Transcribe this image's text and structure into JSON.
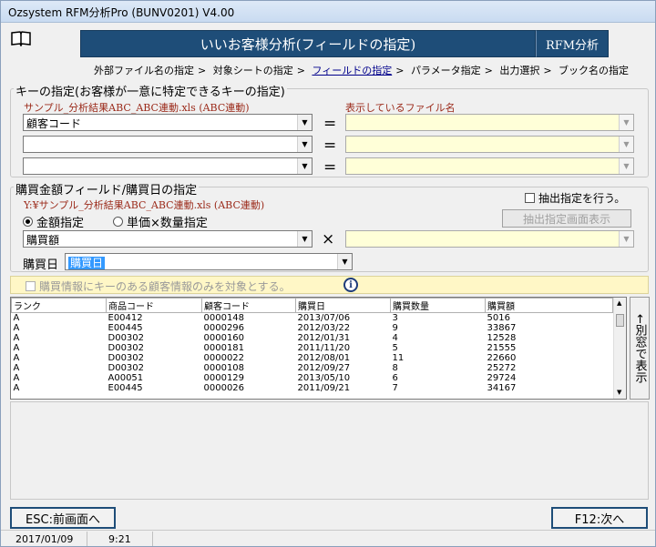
{
  "window": {
    "title": "Ozsystem RFM分析Pro (BUNV0201)   V4.00"
  },
  "header": {
    "title": "いいお客様分析(フィールドの指定)",
    "badge": "RFM分析"
  },
  "breadcrumb": {
    "items": [
      "外部ファイル名の指定",
      "対象シートの指定",
      "フィールドの指定",
      "パラメータ指定",
      "出力選択",
      "ブック名の指定"
    ],
    "separator": ">"
  },
  "key_section": {
    "title": "キーの指定(お客様が一意に特定できるキーの指定)",
    "source_label": "サンプル_分析結果ABC_ABC連動.xls (ABC連動)",
    "display_label": "表示しているファイル名",
    "rows": [
      {
        "left_value": "顧客コード",
        "right_value": ""
      },
      {
        "left_value": "",
        "right_value": ""
      },
      {
        "left_value": "",
        "right_value": ""
      }
    ],
    "equals": "="
  },
  "purchase_section": {
    "title": "購買金額フィールド/購買日の指定",
    "source_label": "Y:¥サンプル_分析結果ABC_ABC連動.xls (ABC連動)",
    "extract_checkbox": "抽出指定を行う。",
    "extract_button": "抽出指定画面表示",
    "radio_amount": "金額指定",
    "radio_unit": "単価×数量指定",
    "amount_value": "購買額",
    "times": "×",
    "qty_value": "",
    "date_label": "購買日",
    "date_value": "購買日"
  },
  "info": {
    "checkbox_label": "購買情報にキーのある顧客情報のみを対象とする。",
    "icon": "i"
  },
  "table": {
    "columns": [
      "ランク",
      "商品コード",
      "顧客コード",
      "購買日",
      "購買数量",
      "購買額"
    ],
    "rows": [
      [
        "A",
        "E00412",
        "0000148",
        "2013/07/06",
        "3",
        "5016"
      ],
      [
        "A",
        "E00445",
        "0000296",
        "2012/03/22",
        "9",
        "33867"
      ],
      [
        "A",
        "D00302",
        "0000160",
        "2012/01/31",
        "4",
        "12528"
      ],
      [
        "A",
        "D00302",
        "0000181",
        "2011/11/20",
        "5",
        "21555"
      ],
      [
        "A",
        "D00302",
        "0000022",
        "2012/08/01",
        "11",
        "22660"
      ],
      [
        "A",
        "D00302",
        "0000108",
        "2012/09/27",
        "8",
        "25272"
      ],
      [
        "A",
        "A00051",
        "0000129",
        "2013/05/10",
        "6",
        "29724"
      ],
      [
        "A",
        "E00445",
        "0000026",
        "2011/09/21",
        "7",
        "34167"
      ]
    ]
  },
  "side_button": "←別窓で表示",
  "buttons": {
    "back": "ESC:前画面へ",
    "next": "F12:次へ"
  },
  "status": {
    "date": "2017/01/09",
    "time": "9:21"
  }
}
